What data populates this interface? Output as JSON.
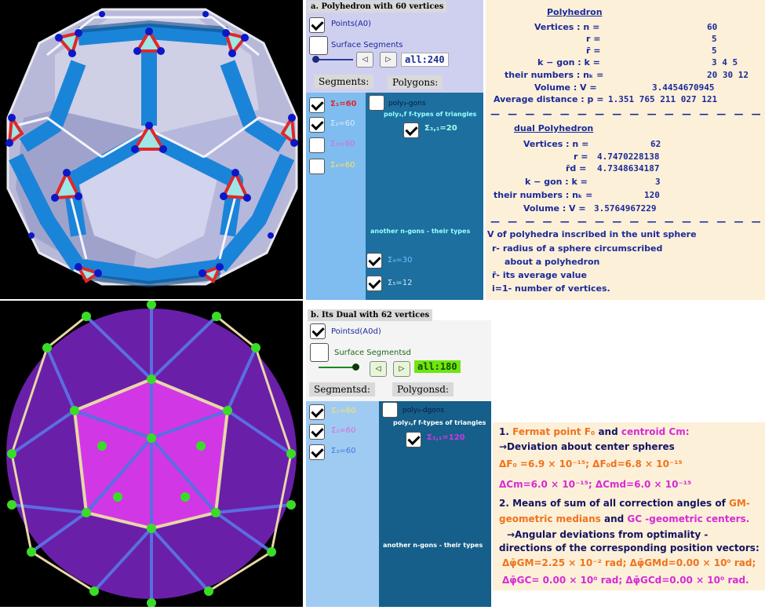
{
  "polyhedron_panel": {
    "title": "a. Polyhedron with 60 vertices",
    "points_label": "Points(A0)",
    "surface_label": "Surface Segments",
    "all_value": "all:240",
    "segments_tab": "Segments:",
    "polygons_tab": "Polygons:",
    "segments": [
      {
        "label": "Σ₁=60",
        "checked": true,
        "color": "#e0282a"
      },
      {
        "label": "Σ₂=60",
        "checked": true,
        "color": "#a8d8ff"
      },
      {
        "label": "Σ₃=60",
        "checked": false,
        "color": "#d96ad6"
      },
      {
        "label": "Σ₄=60",
        "checked": false,
        "color": "#ffe35a"
      }
    ],
    "polys_label": "poly₃-gons",
    "ftypes_label": "poly₃,f  f-types of triangles",
    "sigma31": "Σ₃,₁=20",
    "another_label": "another n-gons -  their types",
    "sigma4": "Σ₄=30",
    "sigma5": "Σ₅=12"
  },
  "polyhedron_info": {
    "heading": "Polyhedron",
    "rows": [
      {
        "label": "Vertices : n =",
        "value": "60"
      },
      {
        "label": "r =",
        "value": "5"
      },
      {
        "label": "r̄ =",
        "value": "5"
      },
      {
        "label": "k − gon : k =",
        "value": "3      4      5"
      },
      {
        "label": "their numbers : nₖ =",
        "value": "20    30    12"
      },
      {
        "label": "Volume : V =",
        "value": "3.4454670945"
      },
      {
        "label": "Average distance : p =",
        "value": "1.351 765 211 027 121"
      }
    ],
    "dual_heading": "dual Polyhedron",
    "dual_rows": [
      {
        "label": "Vertices : n =",
        "value": "62"
      },
      {
        "label": "r =",
        "value": "4.7470228138"
      },
      {
        "label": "r̄d =",
        "value": "4.7348634187"
      },
      {
        "label": "k − gon : k =",
        "value": "3"
      },
      {
        "label": "their numbers : nₖ =",
        "value": "120"
      },
      {
        "label": "Volume : V =",
        "value": "3.5764967229"
      }
    ],
    "notes": [
      "V of polyhedra inscribed in the unit sphere",
      "r-  radius of a sphere circumscribed",
      "about a polyhedron",
      "r̄-  its average value",
      "i=1-  number of  vertices."
    ],
    "dashes": "— — — — — — — — — — — — — — — —"
  },
  "dual_panel": {
    "title": "b. Its Dual with 62  vertices",
    "points_label": "Pointsd(A0d)",
    "surface_label": "Surface Segmentsd",
    "all_value": "all:180",
    "segments_tab": "Segmentsd:",
    "polygons_tab": "Polygonsd:",
    "segments": [
      {
        "label": "Σ₁=60",
        "checked": true,
        "color": "#ffe35a"
      },
      {
        "label": "Σ₂=60",
        "checked": true,
        "color": "#d96ad6"
      },
      {
        "label": "Σ₃=60",
        "checked": true,
        "color": "#6aa6ff"
      }
    ],
    "polys_label": "poly₃-dgons",
    "ftypes_label": "poly₃,f  f-types of triangles",
    "sigma31": "Σ₃,₁=120",
    "another_label": "another n-gons -  their types"
  },
  "dual_info": {
    "line1_prefix": "1.",
    "fermat": "Fermat point  F₀",
    "and": "and",
    "centroid": "centroid Cm:",
    "deviation": "→Deviation about center spheres",
    "delta_f": "ΔF₀ =6.9 × 10⁻¹⁵;",
    "delta_fd": "ΔF₀d=6.8 × 10⁻¹⁵",
    "delta_cm": "ΔCm=6.0 × 10⁻¹⁵;",
    "delta_cmd": "ΔCmd=6.0 × 10⁻¹⁵",
    "line2": "2. Means of sum of all correction angles of",
    "gm": "GM-",
    "line3a": "geometric medians",
    "line3b": "and",
    "gc": "GC -geometric centers.",
    "line4": "→Angular deviations from optimality -",
    "line5": "directions of the corresponding position vectors:",
    "phi_gm": "Δφ̄GM=2.25 × 10⁻² rad;",
    "phi_gmd": "Δφ̄GMd=0.00 × 10⁰ rad;",
    "phi_gc": "Δφ̄GC= 0.00 × 10⁰ rad;",
    "phi_gcd": "Δφ̄GCd=0.00 × 10⁰ rad."
  }
}
